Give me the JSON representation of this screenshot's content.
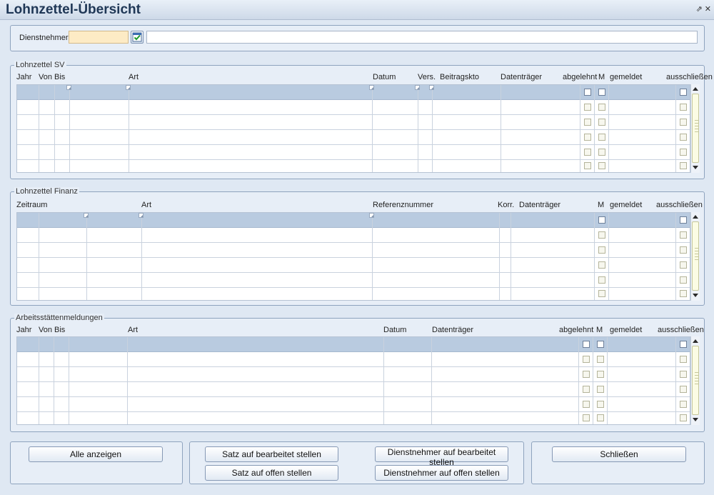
{
  "window": {
    "title": "Lohnzettel-Übersicht"
  },
  "employee": {
    "label": "Dienstnehmer",
    "id_value": "",
    "name_value": ""
  },
  "sv": {
    "legend": "Lohnzettel SV",
    "headers": {
      "jahr": "Jahr",
      "von": "Von",
      "bis": "Bis",
      "art": "Art",
      "datum": "Datum",
      "vers": "Vers.",
      "beitragskto": "Beitragskto",
      "datentraeger": "Datenträger",
      "abgelehnt": "abgelehnt",
      "m": "M",
      "gemeldet": "gemeldet",
      "ausschliessen": "ausschließen"
    },
    "rows": 6
  },
  "finanz": {
    "legend": "Lohnzettel Finanz",
    "headers": {
      "zeitraum": "Zeitraum",
      "art": "Art",
      "referenznummer": "Referenznummer",
      "korr": "Korr.",
      "datentraeger": "Datenträger",
      "m": "M",
      "gemeldet": "gemeldet",
      "ausschliessen": "ausschließen"
    },
    "rows": 6
  },
  "asm": {
    "legend": "Arbeitsstättenmeldungen",
    "headers": {
      "jahr": "Jahr",
      "von": "Von",
      "bis": "Bis",
      "art": "Art",
      "datum": "Datum",
      "datentraeger": "Datenträger",
      "abgelehnt": "abgelehnt",
      "m": "M",
      "gemeldet": "gemeldet",
      "ausschliessen": "ausschließen"
    },
    "rows": 6
  },
  "buttons": {
    "show_all": "Alle anzeigen",
    "record_edited": "Satz auf bearbeitet stellen",
    "record_open": "Satz auf offen stellen",
    "employee_edited": "Dienstnehmer auf bearbeitet stellen",
    "employee_open": "Dienstnehmer auf offen stellen",
    "close": "Schließen"
  }
}
